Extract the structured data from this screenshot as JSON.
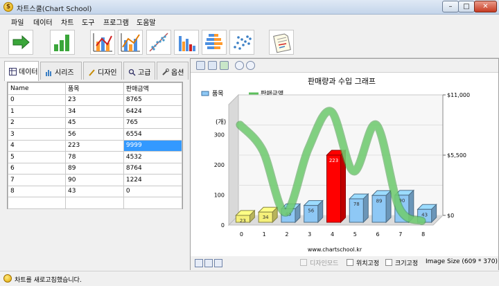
{
  "window": {
    "title": "차트스쿨(Chart School)",
    "min": "–",
    "max": "□",
    "close": "✕"
  },
  "menu": [
    "파일",
    "데이터",
    "차트",
    "도구",
    "프로그램",
    "도움말"
  ],
  "toolbar": [
    "arrow-icon",
    "bar-chart-icon",
    "mixed-chart-icon",
    "line-chart-icon",
    "scatter-line-icon",
    "histogram-icon",
    "pyramid-icon",
    "scatter-icon",
    "memo-icon"
  ],
  "tabs": [
    "데이터",
    "시리즈",
    "디자인",
    "고급",
    "옵션"
  ],
  "table": {
    "headers": [
      "Name",
      "품목",
      "판매금액"
    ],
    "rows": [
      [
        "0",
        "23",
        "8765"
      ],
      [
        "1",
        "34",
        "6424"
      ],
      [
        "2",
        "45",
        "765"
      ],
      [
        "3",
        "56",
        "6554"
      ],
      [
        "4",
        "223",
        "9999"
      ],
      [
        "5",
        "78",
        "4532"
      ],
      [
        "6",
        "89",
        "8764"
      ],
      [
        "7",
        "90",
        "1224"
      ],
      [
        "8",
        "43",
        "0"
      ],
      [
        "",
        "",
        ""
      ]
    ],
    "selected": {
      "row": 4,
      "col": 2
    }
  },
  "chart_data": {
    "type": "bar",
    "title": "판매량과 수입 그래프",
    "categories": [
      "0",
      "1",
      "2",
      "3",
      "4",
      "5",
      "6",
      "7",
      "8"
    ],
    "series": [
      {
        "name": "품목",
        "type": "bar",
        "values": [
          23,
          34,
          45,
          56,
          223,
          78,
          89,
          90,
          43
        ],
        "axis": "left"
      },
      {
        "name": "판매금액",
        "type": "line",
        "values": [
          8765,
          6424,
          765,
          6554,
          9999,
          4532,
          8764,
          1224,
          0
        ],
        "axis": "right"
      }
    ],
    "ylabel": "(개)",
    "ylim": [
      0,
      400
    ],
    "yticks": [
      "0",
      "100",
      "200",
      "300"
    ],
    "y2ticks": [
      "$0",
      "$5,500",
      "$11,000"
    ],
    "y2lim": [
      0,
      11000
    ],
    "colors": {
      "bar": "#8ec8f5",
      "bar_low": "#f5f07a",
      "bar_highlight": "#ff0000",
      "line": "#7ad47a"
    },
    "legend": "top-left",
    "grid": true,
    "watermark": "www.chartschool.kr"
  },
  "footer": {
    "design_mode": "디자인모드",
    "fix_position": "위치고정",
    "fix_size": "크기고정",
    "image_size": "Image Size (609 * 370)"
  },
  "status": "차트를 새로고침했습니다."
}
